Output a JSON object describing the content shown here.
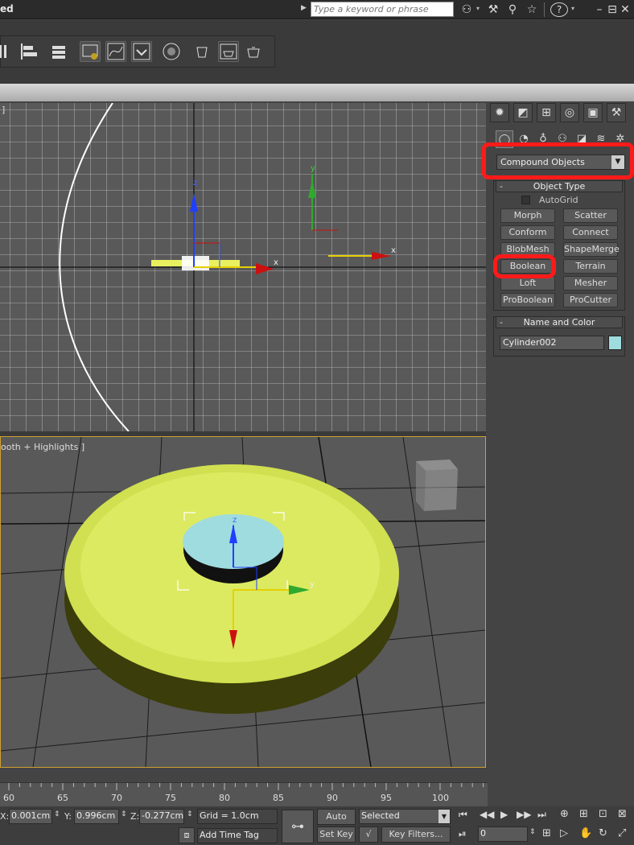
{
  "titlebar": {
    "title": "ed",
    "search_placeholder": "Type a keyword or phrase",
    "icons": [
      "binoculars-icon",
      "wrench-icon",
      "star-icon",
      "help-icon"
    ],
    "window_controls": [
      "–",
      "⊟",
      "✕"
    ]
  },
  "viewport_top": {
    "axis_labels": {
      "z": "z",
      "x": "x",
      "y": "y",
      "x2": "x"
    },
    "corner_label": "]"
  },
  "viewport_bottom": {
    "label": "ooth + Highlights ]",
    "axis_labels": {
      "z": "z",
      "y": "y"
    }
  },
  "command_panel": {
    "tabs": [
      "create",
      "modify",
      "hierarchy",
      "motion",
      "display",
      "utilities"
    ],
    "subtabs": [
      "geometry",
      "shapes",
      "lights",
      "cameras",
      "helpers",
      "spacewarps",
      "systems"
    ],
    "category": "Compound Objects",
    "object_type": {
      "header": "Object Type",
      "autogrid_label": "AutoGrid",
      "buttons": [
        "Morph",
        "Scatter",
        "Conform",
        "Connect",
        "BlobMesh",
        "ShapeMerge",
        "Boolean",
        "Terrain",
        "Loft",
        "Mesher",
        "ProBoolean",
        "ProCutter"
      ]
    },
    "name_color": {
      "header": "Name and Color",
      "name": "Cylinder002",
      "color": "#9fdcdf"
    }
  },
  "timeline": {
    "ticks": [
      "60",
      "65",
      "70",
      "75",
      "80",
      "85",
      "90",
      "95",
      "100"
    ]
  },
  "status": {
    "x_label": "X:",
    "x_value": "0.001cm",
    "y_label": "Y:",
    "y_value": "0.996cm",
    "z_label": "Z:",
    "z_value": "-0.277cm",
    "grid": "Grid = 1.0cm",
    "add_time_tag": "Add Time Tag",
    "auto_key": "Auto Key",
    "set_key": "Set Key",
    "selected": "Selected",
    "key_filters": "Key Filters...",
    "frame": "0"
  }
}
